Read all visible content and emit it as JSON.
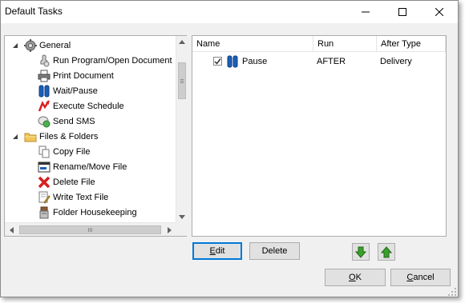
{
  "window": {
    "title": "Default Tasks"
  },
  "tree": {
    "items": [
      {
        "level": 0,
        "expanded": true,
        "label": "General",
        "icon": "gear-icon"
      },
      {
        "level": 1,
        "label": "Run Program/Open Document",
        "icon": "run-program-icon"
      },
      {
        "level": 1,
        "label": "Print Document",
        "icon": "printer-icon"
      },
      {
        "level": 1,
        "label": "Wait/Pause",
        "icon": "pause-icon"
      },
      {
        "level": 1,
        "label": "Execute Schedule",
        "icon": "execute-schedule-icon"
      },
      {
        "level": 1,
        "label": "Send SMS",
        "icon": "sms-icon"
      },
      {
        "level": 0,
        "expanded": true,
        "label": "Files & Folders",
        "icon": "folder-icon"
      },
      {
        "level": 1,
        "label": "Copy File",
        "icon": "copy-file-icon"
      },
      {
        "level": 1,
        "label": "Rename/Move File",
        "icon": "rename-file-icon"
      },
      {
        "level": 1,
        "label": "Delete File",
        "icon": "delete-file-icon"
      },
      {
        "level": 1,
        "label": "Write Text File",
        "icon": "write-text-file-icon"
      },
      {
        "level": 1,
        "label": "Folder Housekeeping",
        "icon": "folder-housekeeping-icon"
      }
    ]
  },
  "tasks": {
    "columns": [
      "Name",
      "Run",
      "After Type"
    ],
    "rows": [
      {
        "checked": true,
        "icon": "pause-icon",
        "name": "Pause",
        "run": "AFTER",
        "after_type": "Delivery"
      }
    ]
  },
  "buttons": {
    "edit": {
      "mnemonic": "E",
      "rest": "dit"
    },
    "delete": "Delete",
    "move_down_icon": "arrow-down-icon",
    "move_up_icon": "arrow-up-icon",
    "ok": {
      "mnemonic": "O",
      "rest": "K"
    },
    "cancel": {
      "mnemonic": "C",
      "rest": "ancel"
    }
  },
  "colors": {
    "accent": "#0078d7",
    "pause_blue": "#1b5fb8",
    "green_arrow": "#3aa02c"
  }
}
